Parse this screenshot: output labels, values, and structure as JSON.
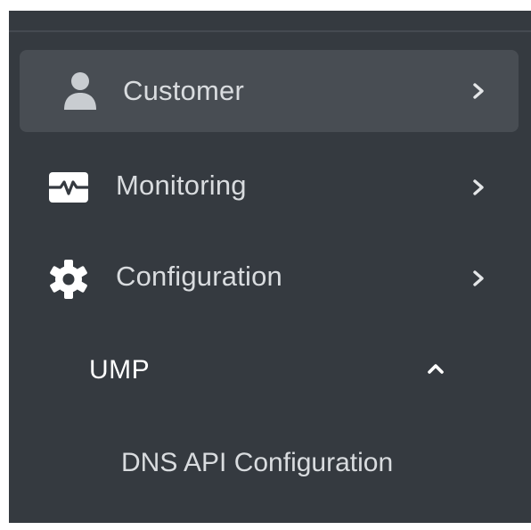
{
  "sidebar": {
    "items": [
      {
        "label": "Customer",
        "icon": "user-icon",
        "active": true
      },
      {
        "label": "Monitoring",
        "icon": "monitor-pulse-icon",
        "active": false
      },
      {
        "label": "Configuration",
        "icon": "gear-icon",
        "active": false
      }
    ],
    "group": {
      "label": "UMP",
      "expanded": true,
      "children": [
        {
          "label": "DNS API Configuration"
        }
      ]
    }
  },
  "colors": {
    "sidebar_bg": "#353a40",
    "active_item_bg": "#484d53",
    "text": "#d9dcdf",
    "group_text": "#ffffff"
  }
}
